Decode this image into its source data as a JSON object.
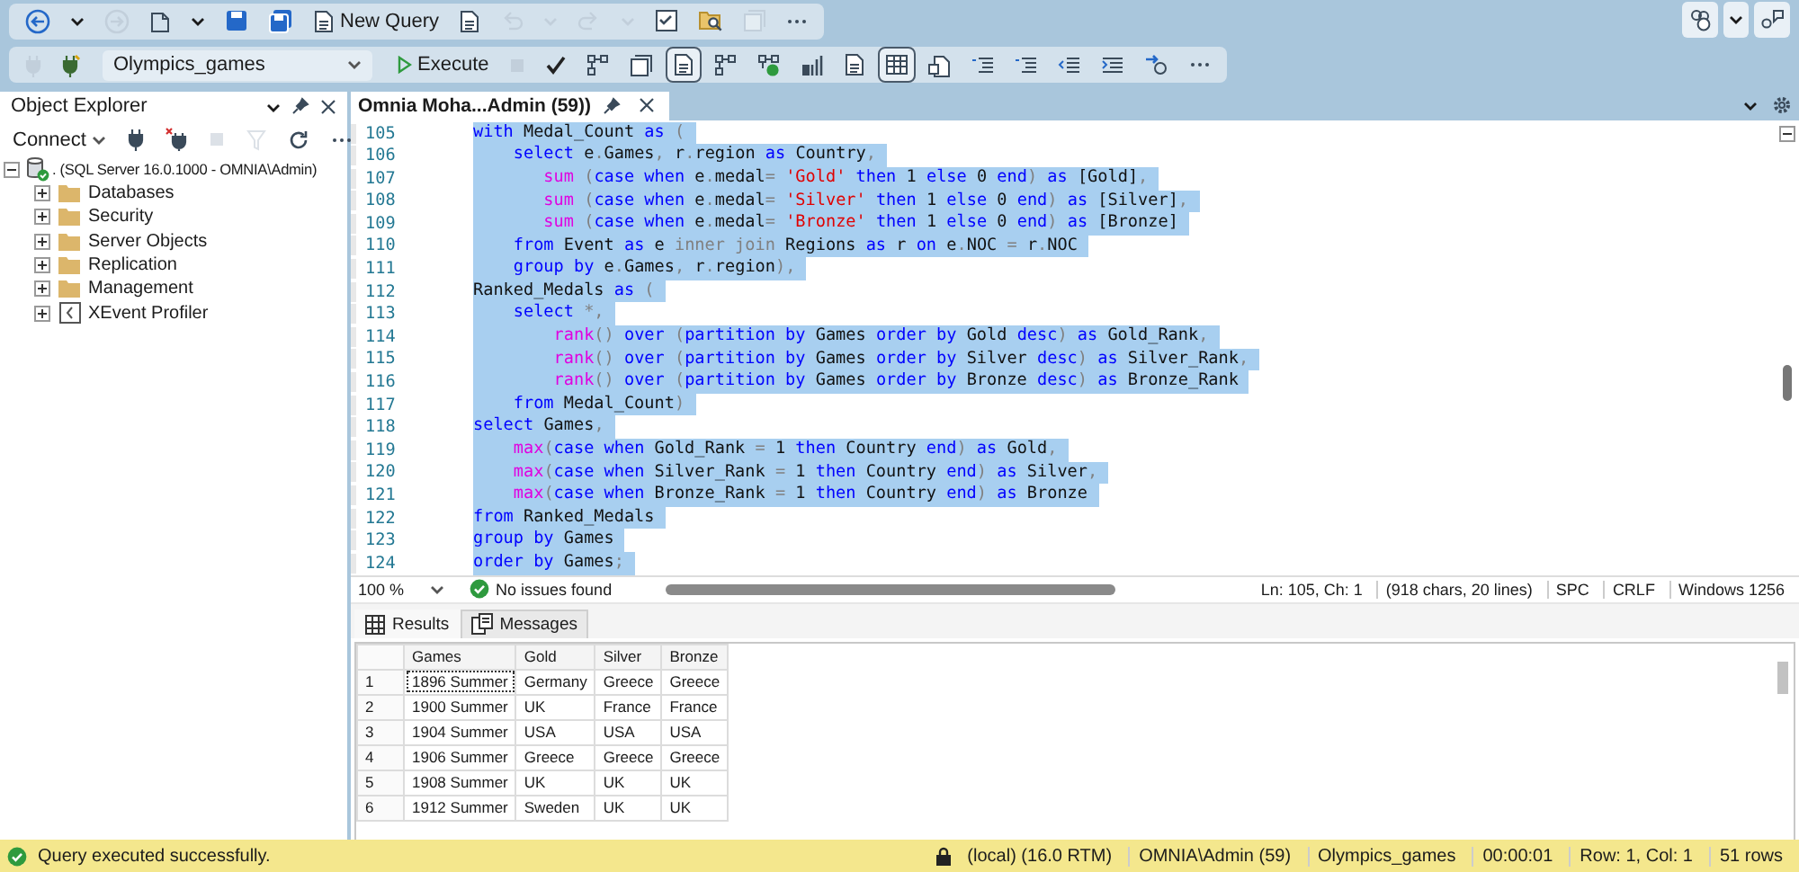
{
  "toolbar": [
    {
      "kind": "back",
      "disabled": false
    },
    {
      "kind": "caret",
      "disabled": false
    },
    {
      "kind": "forward",
      "disabled": true
    },
    {
      "kind": "newfile",
      "disabled": false
    },
    {
      "kind": "caret",
      "disabled": false
    },
    {
      "kind": "save",
      "disabled": false
    },
    {
      "kind": "saveall",
      "disabled": false
    },
    {
      "kind": "newquery",
      "label": "New Query",
      "disabled": false
    },
    {
      "kind": "doc",
      "disabled": false
    },
    {
      "kind": "undo",
      "disabled": true
    },
    {
      "kind": "caret",
      "disabled": true
    },
    {
      "kind": "redo",
      "disabled": true
    },
    {
      "kind": "caret",
      "disabled": true
    },
    {
      "kind": "checklist",
      "disabled": false
    },
    {
      "kind": "foldersearch",
      "disabled": false
    },
    {
      "kind": "window",
      "disabled": true
    },
    {
      "kind": "more",
      "disabled": false
    }
  ],
  "top_right": [
    {
      "kind": "users"
    },
    {
      "kind": "caret"
    },
    {
      "kind": "share"
    }
  ],
  "query_toolbar": [
    {
      "kind": "plug",
      "disabled": true,
      "pressed": false
    },
    {
      "kind": "plugchange",
      "disabled": false,
      "pressed": false
    },
    {
      "kind": "select",
      "value": "Olympics_games",
      "disabled": false,
      "pressed": false
    },
    {
      "kind": "execute",
      "label": "Execute",
      "disabled": false,
      "pressed": false
    },
    {
      "kind": "stop",
      "disabled": true,
      "pressed": false
    },
    {
      "kind": "check",
      "disabled": false,
      "pressed": false
    },
    {
      "kind": "diagram",
      "disabled": false,
      "pressed": false
    },
    {
      "kind": "window",
      "disabled": false,
      "pressed": false
    },
    {
      "kind": "doc",
      "disabled": false,
      "pressed": true
    },
    {
      "kind": "diagram",
      "disabled": false,
      "pressed": false
    },
    {
      "kind": "diagramlive",
      "disabled": false,
      "pressed": false
    },
    {
      "kind": "chart",
      "disabled": false,
      "pressed": false
    },
    {
      "kind": "doc",
      "disabled": false,
      "pressed": false
    },
    {
      "kind": "grid",
      "disabled": false,
      "pressed": true
    },
    {
      "kind": "export",
      "disabled": false,
      "pressed": false
    },
    {
      "kind": "lines",
      "disabled": false,
      "pressed": false
    },
    {
      "kind": "lines",
      "disabled": false,
      "pressed": false
    },
    {
      "kind": "outdent",
      "disabled": false,
      "pressed": false
    },
    {
      "kind": "indent",
      "disabled": false,
      "pressed": false
    },
    {
      "kind": "arrow",
      "disabled": false,
      "pressed": false
    },
    {
      "kind": "more",
      "disabled": false,
      "pressed": false
    }
  ],
  "object_explorer": {
    "title": "Object Explorer",
    "connect": "Connect",
    "tools": [
      {
        "kind": "plug",
        "disabled": false
      },
      {
        "kind": "plugx",
        "disabled": false
      },
      {
        "kind": "stop",
        "disabled": true
      },
      {
        "kind": "filter",
        "disabled": true
      },
      {
        "kind": "refresh",
        "disabled": false
      },
      {
        "kind": "more",
        "disabled": false
      }
    ],
    "tree": [
      {
        "label": ". (SQL Server 16.0.1000 - OMNIA\\Admin)",
        "kind": "server",
        "expanded": true,
        "children": [
          {
            "label": "Databases",
            "kind": "folder",
            "expanded": false
          },
          {
            "label": "Security",
            "kind": "folder",
            "expanded": false
          },
          {
            "label": "Server Objects",
            "kind": "folder",
            "expanded": false
          },
          {
            "label": "Replication",
            "kind": "folder",
            "expanded": false
          },
          {
            "label": "Management",
            "kind": "folder",
            "expanded": false
          },
          {
            "label": "XEvent Profiler",
            "kind": "profiler",
            "expanded": false
          }
        ]
      }
    ]
  },
  "editor": {
    "tabs": [
      {
        "title": "Omnia Moha...Admin (59))",
        "selected": true
      }
    ],
    "lines": [
      {
        "number": "105",
        "selected": true,
        "tokens": [
          {
            "kind": "keyword",
            "text": "with"
          },
          {
            "kind": "plain",
            "text": " Medal_Count "
          },
          {
            "kind": "keyword",
            "text": "as"
          },
          {
            "kind": "operator",
            "text": " ("
          }
        ]
      },
      {
        "number": "106",
        "selected": true,
        "tokens": [
          {
            "kind": "keyword",
            "text": "    select"
          },
          {
            "kind": "plain",
            "text": " e"
          },
          {
            "kind": "operator",
            "text": "."
          },
          {
            "kind": "plain",
            "text": "Games"
          },
          {
            "kind": "operator",
            "text": ","
          },
          {
            "kind": "plain",
            "text": " r"
          },
          {
            "kind": "operator",
            "text": "."
          },
          {
            "kind": "plain",
            "text": "region "
          },
          {
            "kind": "keyword",
            "text": "as"
          },
          {
            "kind": "plain",
            "text": " Country"
          },
          {
            "kind": "operator",
            "text": ","
          }
        ]
      },
      {
        "number": "107",
        "selected": true,
        "tokens": [
          {
            "kind": "function",
            "text": "       sum"
          },
          {
            "kind": "operator",
            "text": " ("
          },
          {
            "kind": "keyword",
            "text": "case when"
          },
          {
            "kind": "plain",
            "text": " e"
          },
          {
            "kind": "operator",
            "text": "."
          },
          {
            "kind": "plain",
            "text": "medal"
          },
          {
            "kind": "operator",
            "text": "="
          },
          {
            "kind": "string",
            "text": " 'Gold'"
          },
          {
            "kind": "keyword",
            "text": " then"
          },
          {
            "kind": "plain",
            "text": " 1 "
          },
          {
            "kind": "keyword",
            "text": "else"
          },
          {
            "kind": "plain",
            "text": " 0 "
          },
          {
            "kind": "keyword",
            "text": "end"
          },
          {
            "kind": "operator",
            "text": ")"
          },
          {
            "kind": "keyword",
            "text": " as"
          },
          {
            "kind": "plain",
            "text": " [Gold]"
          },
          {
            "kind": "operator",
            "text": ","
          }
        ]
      },
      {
        "number": "108",
        "selected": true,
        "tokens": [
          {
            "kind": "function",
            "text": "       sum"
          },
          {
            "kind": "operator",
            "text": " ("
          },
          {
            "kind": "keyword",
            "text": "case when"
          },
          {
            "kind": "plain",
            "text": " e"
          },
          {
            "kind": "operator",
            "text": "."
          },
          {
            "kind": "plain",
            "text": "medal"
          },
          {
            "kind": "operator",
            "text": "="
          },
          {
            "kind": "string",
            "text": " 'Silver'"
          },
          {
            "kind": "keyword",
            "text": " then"
          },
          {
            "kind": "plain",
            "text": " 1 "
          },
          {
            "kind": "keyword",
            "text": "else"
          },
          {
            "kind": "plain",
            "text": " 0 "
          },
          {
            "kind": "keyword",
            "text": "end"
          },
          {
            "kind": "operator",
            "text": ")"
          },
          {
            "kind": "keyword",
            "text": " as"
          },
          {
            "kind": "plain",
            "text": " [Silver]"
          },
          {
            "kind": "operator",
            "text": ","
          }
        ]
      },
      {
        "number": "109",
        "selected": true,
        "tokens": [
          {
            "kind": "function",
            "text": "       sum"
          },
          {
            "kind": "operator",
            "text": " ("
          },
          {
            "kind": "keyword",
            "text": "case when"
          },
          {
            "kind": "plain",
            "text": " e"
          },
          {
            "kind": "operator",
            "text": "."
          },
          {
            "kind": "plain",
            "text": "medal"
          },
          {
            "kind": "operator",
            "text": "="
          },
          {
            "kind": "string",
            "text": " 'Bronze'"
          },
          {
            "kind": "keyword",
            "text": " then"
          },
          {
            "kind": "plain",
            "text": " 1 "
          },
          {
            "kind": "keyword",
            "text": "else"
          },
          {
            "kind": "plain",
            "text": " 0 "
          },
          {
            "kind": "keyword",
            "text": "end"
          },
          {
            "kind": "operator",
            "text": ")"
          },
          {
            "kind": "keyword",
            "text": " as"
          },
          {
            "kind": "plain",
            "text": " [Bronze]"
          }
        ]
      },
      {
        "number": "110",
        "selected": true,
        "tokens": [
          {
            "kind": "keyword",
            "text": "    from"
          },
          {
            "kind": "plain",
            "text": " Event "
          },
          {
            "kind": "keyword",
            "text": "as"
          },
          {
            "kind": "plain",
            "text": " e "
          },
          {
            "kind": "operator",
            "text": "inner join"
          },
          {
            "kind": "plain",
            "text": " Regions "
          },
          {
            "kind": "keyword",
            "text": "as"
          },
          {
            "kind": "plain",
            "text": " r "
          },
          {
            "kind": "keyword",
            "text": "on"
          },
          {
            "kind": "plain",
            "text": " e"
          },
          {
            "kind": "operator",
            "text": "."
          },
          {
            "kind": "plain",
            "text": "NOC "
          },
          {
            "kind": "operator",
            "text": "="
          },
          {
            "kind": "plain",
            "text": " r"
          },
          {
            "kind": "operator",
            "text": "."
          },
          {
            "kind": "plain",
            "text": "NOC"
          }
        ]
      },
      {
        "number": "111",
        "selected": true,
        "tokens": [
          {
            "kind": "keyword",
            "text": "    group by"
          },
          {
            "kind": "plain",
            "text": " e"
          },
          {
            "kind": "operator",
            "text": "."
          },
          {
            "kind": "plain",
            "text": "Games"
          },
          {
            "kind": "operator",
            "text": ","
          },
          {
            "kind": "plain",
            "text": " r"
          },
          {
            "kind": "operator",
            "text": "."
          },
          {
            "kind": "plain",
            "text": "region"
          },
          {
            "kind": "operator",
            "text": "),"
          }
        ]
      },
      {
        "number": "112",
        "selected": true,
        "tokens": [
          {
            "kind": "plain",
            "text": "Ranked_Medals "
          },
          {
            "kind": "keyword",
            "text": "as"
          },
          {
            "kind": "operator",
            "text": " ("
          }
        ]
      },
      {
        "number": "113",
        "selected": true,
        "tokens": [
          {
            "kind": "keyword",
            "text": "    select"
          },
          {
            "kind": "operator",
            "text": " *,"
          }
        ]
      },
      {
        "number": "114",
        "selected": true,
        "tokens": [
          {
            "kind": "function",
            "text": "        rank"
          },
          {
            "kind": "operator",
            "text": "()"
          },
          {
            "kind": "keyword",
            "text": " over"
          },
          {
            "kind": "operator",
            "text": " ("
          },
          {
            "kind": "keyword",
            "text": "partition by"
          },
          {
            "kind": "plain",
            "text": " Games "
          },
          {
            "kind": "keyword",
            "text": "order by"
          },
          {
            "kind": "plain",
            "text": " Gold "
          },
          {
            "kind": "keyword",
            "text": "desc"
          },
          {
            "kind": "operator",
            "text": ")"
          },
          {
            "kind": "keyword",
            "text": " as"
          },
          {
            "kind": "plain",
            "text": " Gold_Rank"
          },
          {
            "kind": "operator",
            "text": ","
          }
        ]
      },
      {
        "number": "115",
        "selected": true,
        "tokens": [
          {
            "kind": "function",
            "text": "        rank"
          },
          {
            "kind": "operator",
            "text": "()"
          },
          {
            "kind": "keyword",
            "text": " over"
          },
          {
            "kind": "operator",
            "text": " ("
          },
          {
            "kind": "keyword",
            "text": "partition by"
          },
          {
            "kind": "plain",
            "text": " Games "
          },
          {
            "kind": "keyword",
            "text": "order by"
          },
          {
            "kind": "plain",
            "text": " Silver "
          },
          {
            "kind": "keyword",
            "text": "desc"
          },
          {
            "kind": "operator",
            "text": ")"
          },
          {
            "kind": "keyword",
            "text": " as"
          },
          {
            "kind": "plain",
            "text": " Silver_Rank"
          },
          {
            "kind": "operator",
            "text": ","
          }
        ]
      },
      {
        "number": "116",
        "selected": true,
        "tokens": [
          {
            "kind": "function",
            "text": "        rank"
          },
          {
            "kind": "operator",
            "text": "()"
          },
          {
            "kind": "keyword",
            "text": " over"
          },
          {
            "kind": "operator",
            "text": " ("
          },
          {
            "kind": "keyword",
            "text": "partition by"
          },
          {
            "kind": "plain",
            "text": " Games "
          },
          {
            "kind": "keyword",
            "text": "order by"
          },
          {
            "kind": "plain",
            "text": " Bronze "
          },
          {
            "kind": "keyword",
            "text": "desc"
          },
          {
            "kind": "operator",
            "text": ")"
          },
          {
            "kind": "keyword",
            "text": " as"
          },
          {
            "kind": "plain",
            "text": " Bronze_Rank"
          }
        ]
      },
      {
        "number": "117",
        "selected": true,
        "tokens": [
          {
            "kind": "keyword",
            "text": "    from"
          },
          {
            "kind": "plain",
            "text": " Medal_Count"
          },
          {
            "kind": "operator",
            "text": ")"
          }
        ]
      },
      {
        "number": "118",
        "selected": true,
        "tokens": [
          {
            "kind": "keyword",
            "text": "select"
          },
          {
            "kind": "plain",
            "text": " Games"
          },
          {
            "kind": "operator",
            "text": ","
          }
        ]
      },
      {
        "number": "119",
        "selected": true,
        "tokens": [
          {
            "kind": "function",
            "text": "    max"
          },
          {
            "kind": "operator",
            "text": "("
          },
          {
            "kind": "keyword",
            "text": "case when"
          },
          {
            "kind": "plain",
            "text": " Gold_Rank "
          },
          {
            "kind": "operator",
            "text": "="
          },
          {
            "kind": "plain",
            "text": " 1 "
          },
          {
            "kind": "keyword",
            "text": "then"
          },
          {
            "kind": "plain",
            "text": " Country "
          },
          {
            "kind": "keyword",
            "text": "end"
          },
          {
            "kind": "operator",
            "text": ")"
          },
          {
            "kind": "keyword",
            "text": " as"
          },
          {
            "kind": "plain",
            "text": " Gold"
          },
          {
            "kind": "operator",
            "text": ","
          }
        ]
      },
      {
        "number": "120",
        "selected": true,
        "tokens": [
          {
            "kind": "function",
            "text": "    max"
          },
          {
            "kind": "operator",
            "text": "("
          },
          {
            "kind": "keyword",
            "text": "case when"
          },
          {
            "kind": "plain",
            "text": " Silver_Rank "
          },
          {
            "kind": "operator",
            "text": "="
          },
          {
            "kind": "plain",
            "text": " 1 "
          },
          {
            "kind": "keyword",
            "text": "then"
          },
          {
            "kind": "plain",
            "text": " Country "
          },
          {
            "kind": "keyword",
            "text": "end"
          },
          {
            "kind": "operator",
            "text": ")"
          },
          {
            "kind": "keyword",
            "text": " as"
          },
          {
            "kind": "plain",
            "text": " Silver"
          },
          {
            "kind": "operator",
            "text": ","
          }
        ]
      },
      {
        "number": "121",
        "selected": true,
        "tokens": [
          {
            "kind": "function",
            "text": "    max"
          },
          {
            "kind": "operator",
            "text": "("
          },
          {
            "kind": "keyword",
            "text": "case when"
          },
          {
            "kind": "plain",
            "text": " Bronze_Rank "
          },
          {
            "kind": "operator",
            "text": "="
          },
          {
            "kind": "plain",
            "text": " 1 "
          },
          {
            "kind": "keyword",
            "text": "then"
          },
          {
            "kind": "plain",
            "text": " Country "
          },
          {
            "kind": "keyword",
            "text": "end"
          },
          {
            "kind": "operator",
            "text": ")"
          },
          {
            "kind": "keyword",
            "text": " as"
          },
          {
            "kind": "plain",
            "text": " Bronze"
          }
        ]
      },
      {
        "number": "122",
        "selected": true,
        "tokens": [
          {
            "kind": "keyword",
            "text": "from"
          },
          {
            "kind": "plain",
            "text": " Ranked_Medals"
          }
        ]
      },
      {
        "number": "123",
        "selected": true,
        "tokens": [
          {
            "kind": "keyword",
            "text": "group by"
          },
          {
            "kind": "plain",
            "text": " Games"
          }
        ]
      },
      {
        "number": "124",
        "selected": true,
        "tokens": [
          {
            "kind": "keyword",
            "text": "order by"
          },
          {
            "kind": "plain",
            "text": " Games"
          },
          {
            "kind": "operator",
            "text": ";"
          }
        ]
      }
    ],
    "status": {
      "zoom": "100 %",
      "issues": "No issues found",
      "fields": [
        "Ln: 105, Ch: 1",
        "(918 chars, 20 lines)",
        "SPC",
        "CRLF",
        "Windows 1256"
      ]
    }
  },
  "results": {
    "tabs": [
      {
        "label": "Results",
        "kind": "grid",
        "selected": true
      },
      {
        "label": "Messages",
        "kind": "messages",
        "selected": false
      }
    ],
    "columns": [
      "Games",
      "Gold",
      "Silver",
      "Bronze"
    ],
    "rows": [
      {
        "number": "1",
        "focused": true,
        "cells": [
          "1896 Summer",
          "Germany",
          "Greece",
          "Greece"
        ]
      },
      {
        "number": "2",
        "focused": false,
        "cells": [
          "1900 Summer",
          "UK",
          "France",
          "France"
        ]
      },
      {
        "number": "3",
        "focused": false,
        "cells": [
          "1904 Summer",
          "USA",
          "USA",
          "USA"
        ]
      },
      {
        "number": "4",
        "focused": false,
        "cells": [
          "1906 Summer",
          "Greece",
          "Greece",
          "Greece"
        ]
      },
      {
        "number": "5",
        "focused": false,
        "cells": [
          "1908 Summer",
          "UK",
          "UK",
          "UK"
        ]
      },
      {
        "number": "6",
        "focused": false,
        "cells": [
          "1912 Summer",
          "Sweden",
          "UK",
          "UK"
        ]
      }
    ]
  },
  "status_bar": {
    "message": "Query executed successfully.",
    "segments": [
      {
        "text": "(local) (16.0 RTM)",
        "kind": "lock"
      },
      {
        "text": "OMNIA\\Admin (59)",
        "kind": "plain"
      },
      {
        "text": "Olympics_games",
        "kind": "plain"
      },
      {
        "text": "00:00:01",
        "kind": "plain"
      },
      {
        "text": "Row: 1, Col: 1",
        "kind": "plain"
      },
      {
        "text": "51 rows",
        "kind": "plain"
      }
    ]
  }
}
